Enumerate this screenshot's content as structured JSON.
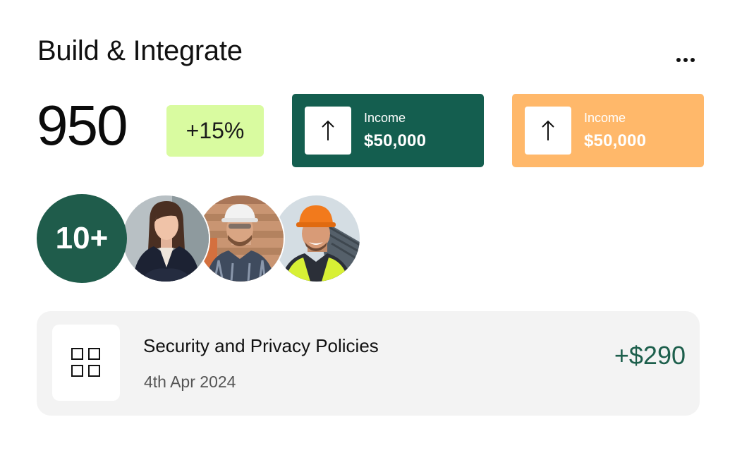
{
  "header": {
    "title": "Build & Integrate",
    "menu_icon": "more-horizontal-icon"
  },
  "summary": {
    "value": "950",
    "change": "+15%",
    "change_bg": "#d9fba0"
  },
  "stats": [
    {
      "label": "Income",
      "value": "$50,000",
      "icon": "arrow-up-icon",
      "bg": "#145e4f"
    },
    {
      "label": "Income",
      "value": "$50,000",
      "icon": "arrow-up-icon",
      "bg": "#ffb86a"
    }
  ],
  "team": {
    "count_label": "10+",
    "members": [
      "woman-in-suit",
      "worker-white-helmet",
      "worker-orange-helmet"
    ]
  },
  "transaction": {
    "title": "Security and Privacy Policies",
    "date": "4th Apr 2024",
    "amount": "+$290",
    "icon": "grid-icon",
    "amount_color": "#1d5f4c"
  }
}
